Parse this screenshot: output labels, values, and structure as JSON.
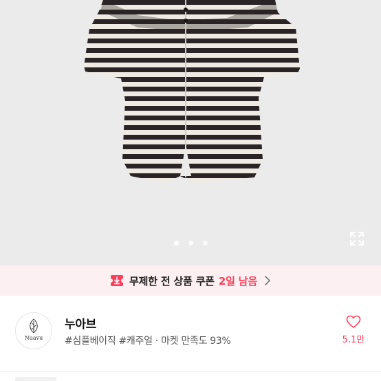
{
  "gallery": {
    "current_index": 1,
    "total_images": 3,
    "expand_icon": "expand-arrows-icon"
  },
  "coupon": {
    "icon": "download-coupon-icon",
    "label": "무제한 전 상품 쿠폰",
    "days_left": "2일 남음",
    "accent_color": "#ff3d5a",
    "background_color": "#fdf0f2"
  },
  "shop": {
    "logo_text": "Nuavu",
    "name": "누아브",
    "tags": "#심플베이직 #캐주얼 · 마켓 만족도 93%",
    "likes": "5.1만"
  }
}
